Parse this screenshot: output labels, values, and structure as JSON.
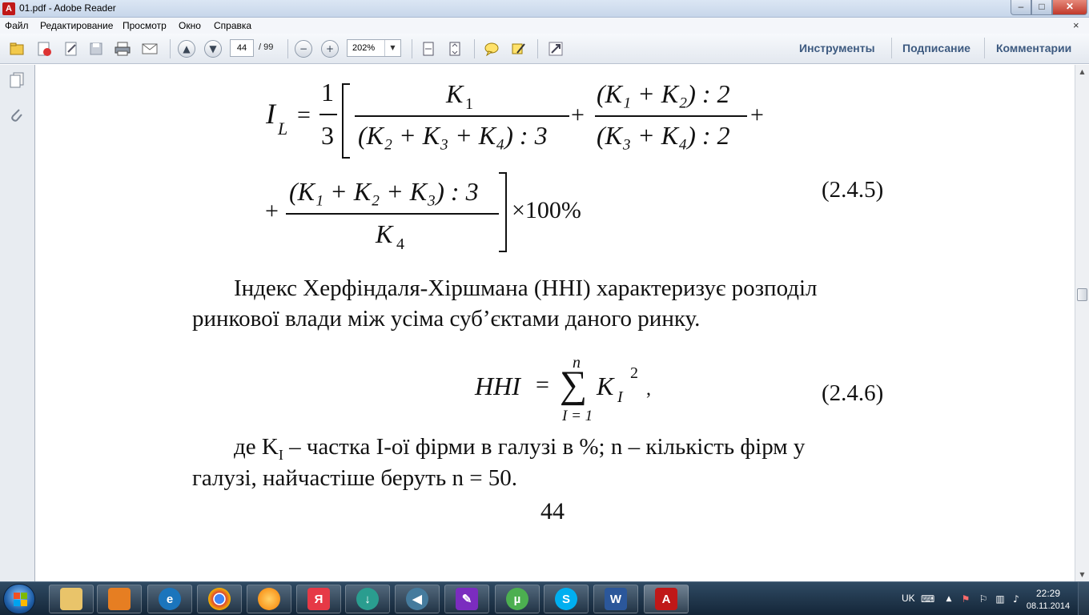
{
  "window": {
    "title": "01.pdf - Adobe Reader",
    "app_icon": "acrobat-icon",
    "minimize": "–",
    "maximize": "□",
    "close": "✕"
  },
  "menu": {
    "items": [
      "Файл",
      "Редактирование",
      "Просмотр",
      "Окно",
      "Справка"
    ],
    "close_doc": "×"
  },
  "toolbar": {
    "page_current": "44",
    "page_total": "/ 99",
    "zoom": "202%",
    "links": [
      "Инструменты",
      "Подписание",
      "Комментарии"
    ]
  },
  "document": {
    "formula1": {
      "lhs": "I",
      "lhs_sub": "L",
      "eq": "=",
      "coef_num": "1",
      "coef_den": "3",
      "t1_num": "K",
      "t1_num_sub": "1",
      "t1_den": "(K₂ + K₃ + K₄) : 3",
      "t2_num": "(K₁ + K₂) : 2",
      "t2_den": "(K₃ + K₄) : 2",
      "t3_num": "(K₁ + K₂ + K₃) : 3",
      "t3_den": "K",
      "t3_den_sub": "4",
      "plus": "+",
      "times100": "×100%",
      "number": "(2.4.5)"
    },
    "paragraph1": [
      "Індекс Херфіндаля-Хіршмана (ННІ) характеризує розподіл",
      "ринкової влади між усіма суб’єктами даного ринку."
    ],
    "formula2": {
      "lhs": "HHI",
      "eq": "=",
      "sigma": "∑",
      "upper": "n",
      "lower": "I = 1",
      "term": "K",
      "term_sub": "I",
      "term_sup": "2",
      "comma": ",",
      "number": "(2.4.6)"
    },
    "paragraph2": {
      "line1_a": "де K",
      "line1_sub": "I",
      "line1_b": " – частка І-ої фірми в галузі в %; n – кількість фірм у",
      "line2": "галузі, найчастіше беруть n = 50."
    },
    "page_number": "44"
  },
  "taskbar": {
    "apps": [
      {
        "name": "explorer",
        "label": ""
      },
      {
        "name": "media-player",
        "label": ""
      },
      {
        "name": "internet-explorer",
        "label": "e"
      },
      {
        "name": "chrome",
        "label": ""
      },
      {
        "name": "browser-orange",
        "label": ""
      },
      {
        "name": "yandex",
        "label": "Я"
      },
      {
        "name": "downloader",
        "label": "↓"
      },
      {
        "name": "audio",
        "label": "◀"
      },
      {
        "name": "purple-app",
        "label": "✎"
      },
      {
        "name": "utorrent",
        "label": "µ"
      },
      {
        "name": "skype",
        "label": "S"
      },
      {
        "name": "word",
        "label": "W"
      },
      {
        "name": "acrobat",
        "label": "A"
      }
    ],
    "tray_lang": "UK",
    "clock_time": "22:29",
    "clock_date": "08.11.2014"
  }
}
